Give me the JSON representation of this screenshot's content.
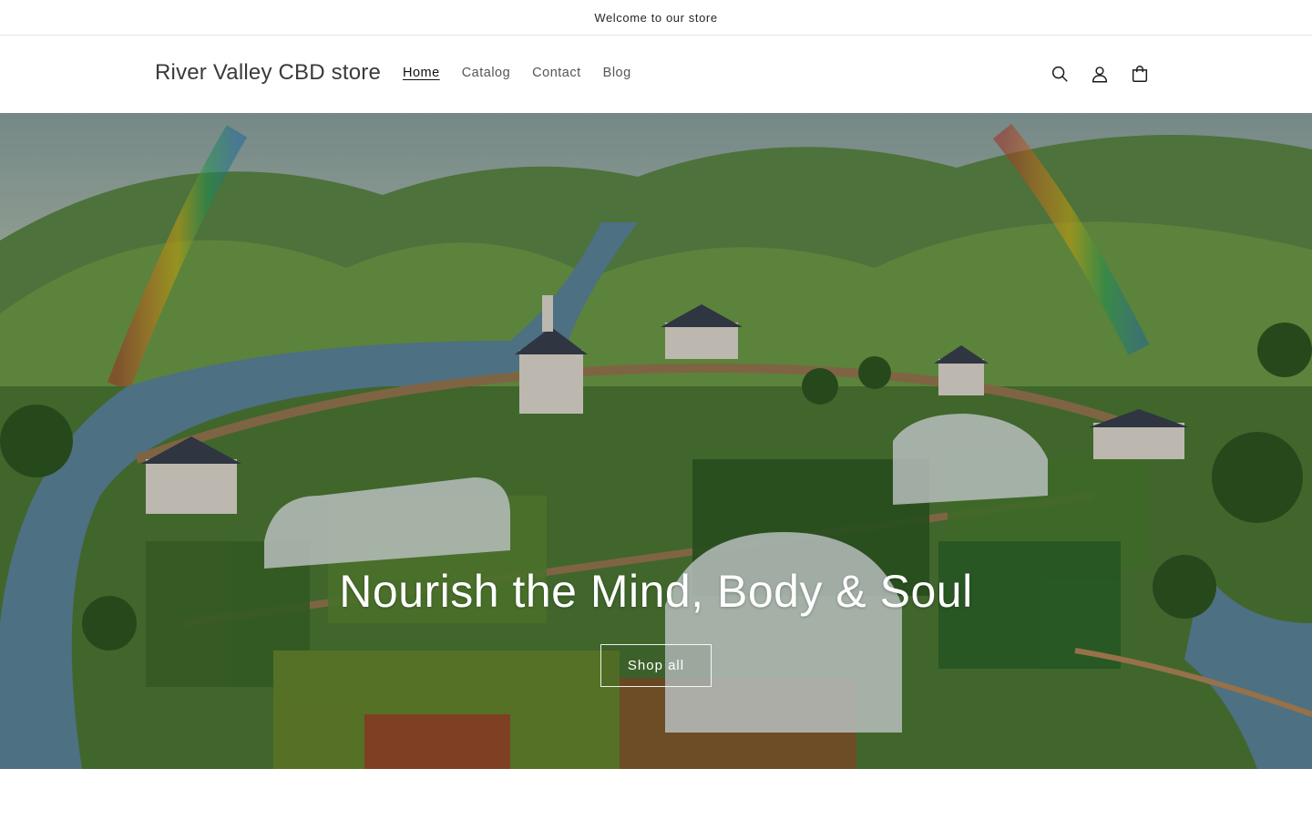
{
  "announcement": {
    "text": "Welcome to our store"
  },
  "header": {
    "logo": "River Valley CBD store",
    "nav": [
      {
        "label": "Home",
        "active": true
      },
      {
        "label": "Catalog",
        "active": false
      },
      {
        "label": "Contact",
        "active": false
      },
      {
        "label": "Blog",
        "active": false
      }
    ],
    "icons": [
      "search-icon",
      "account-icon",
      "cart-icon"
    ]
  },
  "hero": {
    "title": "Nourish the Mind, Body & Soul",
    "button_label": "Shop all"
  },
  "colors": {
    "text": "#121212",
    "background": "#ffffff",
    "border": "#e6e6e6",
    "hero_text": "#ffffff"
  }
}
